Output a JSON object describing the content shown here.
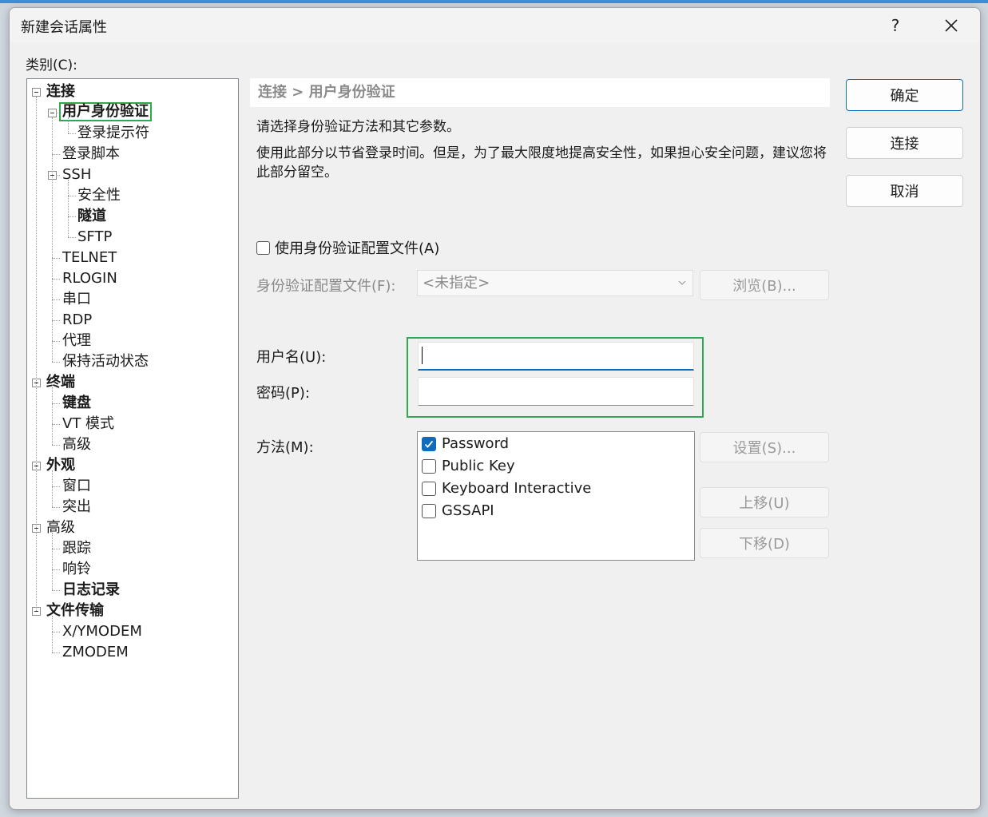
{
  "window": {
    "title": "新建会话属性",
    "help_label": "?",
    "close_icon": "close-icon"
  },
  "category": {
    "label": "类别(C):",
    "tree": [
      {
        "label": "连接",
        "bold": true,
        "level": 0,
        "expanded": true
      },
      {
        "label": "用户身份验证",
        "bold": true,
        "level": 1,
        "expanded": true,
        "selected": true
      },
      {
        "label": "登录提示符",
        "bold": false,
        "level": 2
      },
      {
        "label": "登录脚本",
        "bold": false,
        "level": 1
      },
      {
        "label": "SSH",
        "bold": false,
        "level": 1,
        "expanded": true
      },
      {
        "label": "安全性",
        "bold": false,
        "level": 2
      },
      {
        "label": "隧道",
        "bold": true,
        "level": 2
      },
      {
        "label": "SFTP",
        "bold": false,
        "level": 2
      },
      {
        "label": "TELNET",
        "bold": false,
        "level": 1
      },
      {
        "label": "RLOGIN",
        "bold": false,
        "level": 1
      },
      {
        "label": "串口",
        "bold": false,
        "level": 1
      },
      {
        "label": "RDP",
        "bold": false,
        "level": 1
      },
      {
        "label": "代理",
        "bold": false,
        "level": 1
      },
      {
        "label": "保持活动状态",
        "bold": false,
        "level": 1
      },
      {
        "label": "终端",
        "bold": true,
        "level": 0,
        "expanded": true
      },
      {
        "label": "键盘",
        "bold": true,
        "level": 1
      },
      {
        "label": "VT 模式",
        "bold": false,
        "level": 1
      },
      {
        "label": "高级",
        "bold": false,
        "level": 1
      },
      {
        "label": "外观",
        "bold": true,
        "level": 0,
        "expanded": true
      },
      {
        "label": "窗口",
        "bold": false,
        "level": 1
      },
      {
        "label": "突出",
        "bold": false,
        "level": 1
      },
      {
        "label": "高级",
        "bold": false,
        "level": 0,
        "expanded": true
      },
      {
        "label": "跟踪",
        "bold": false,
        "level": 1
      },
      {
        "label": "响铃",
        "bold": false,
        "level": 1
      },
      {
        "label": "日志记录",
        "bold": true,
        "level": 1
      },
      {
        "label": "文件传输",
        "bold": true,
        "level": 0,
        "expanded": true
      },
      {
        "label": "X/YMODEM",
        "bold": false,
        "level": 1
      },
      {
        "label": "ZMODEM",
        "bold": false,
        "level": 1
      }
    ]
  },
  "panel": {
    "breadcrumb": "连接 > 用户身份验证",
    "desc1": "请选择身份验证方法和其它参数。",
    "desc2": "使用此部分以节省登录时间。但是，为了最大限度地提高安全性，如果担心安全问题，建议您将此部分留空。",
    "use_profile_label": "使用身份验证配置文件(A)",
    "use_profile_checked": false,
    "profile_label": "身份验证配置文件(F):",
    "profile_value": "<未指定>",
    "browse_label": "浏览(B)...",
    "username_label": "用户名(U):",
    "username_value": "",
    "password_label": "密码(P):",
    "password_value": "",
    "method_label": "方法(M):",
    "methods": [
      {
        "label": "Password",
        "checked": true
      },
      {
        "label": "Public Key",
        "checked": false
      },
      {
        "label": "Keyboard Interactive",
        "checked": false
      },
      {
        "label": "GSSAPI",
        "checked": false
      }
    ],
    "settings_label": "设置(S)...",
    "move_up_label": "上移(U)",
    "move_down_label": "下移(D)"
  },
  "buttons": {
    "ok": "确定",
    "connect": "连接",
    "cancel": "取消"
  },
  "colors": {
    "accent": "#0f6cbd",
    "highlight": "#2fa84f"
  }
}
